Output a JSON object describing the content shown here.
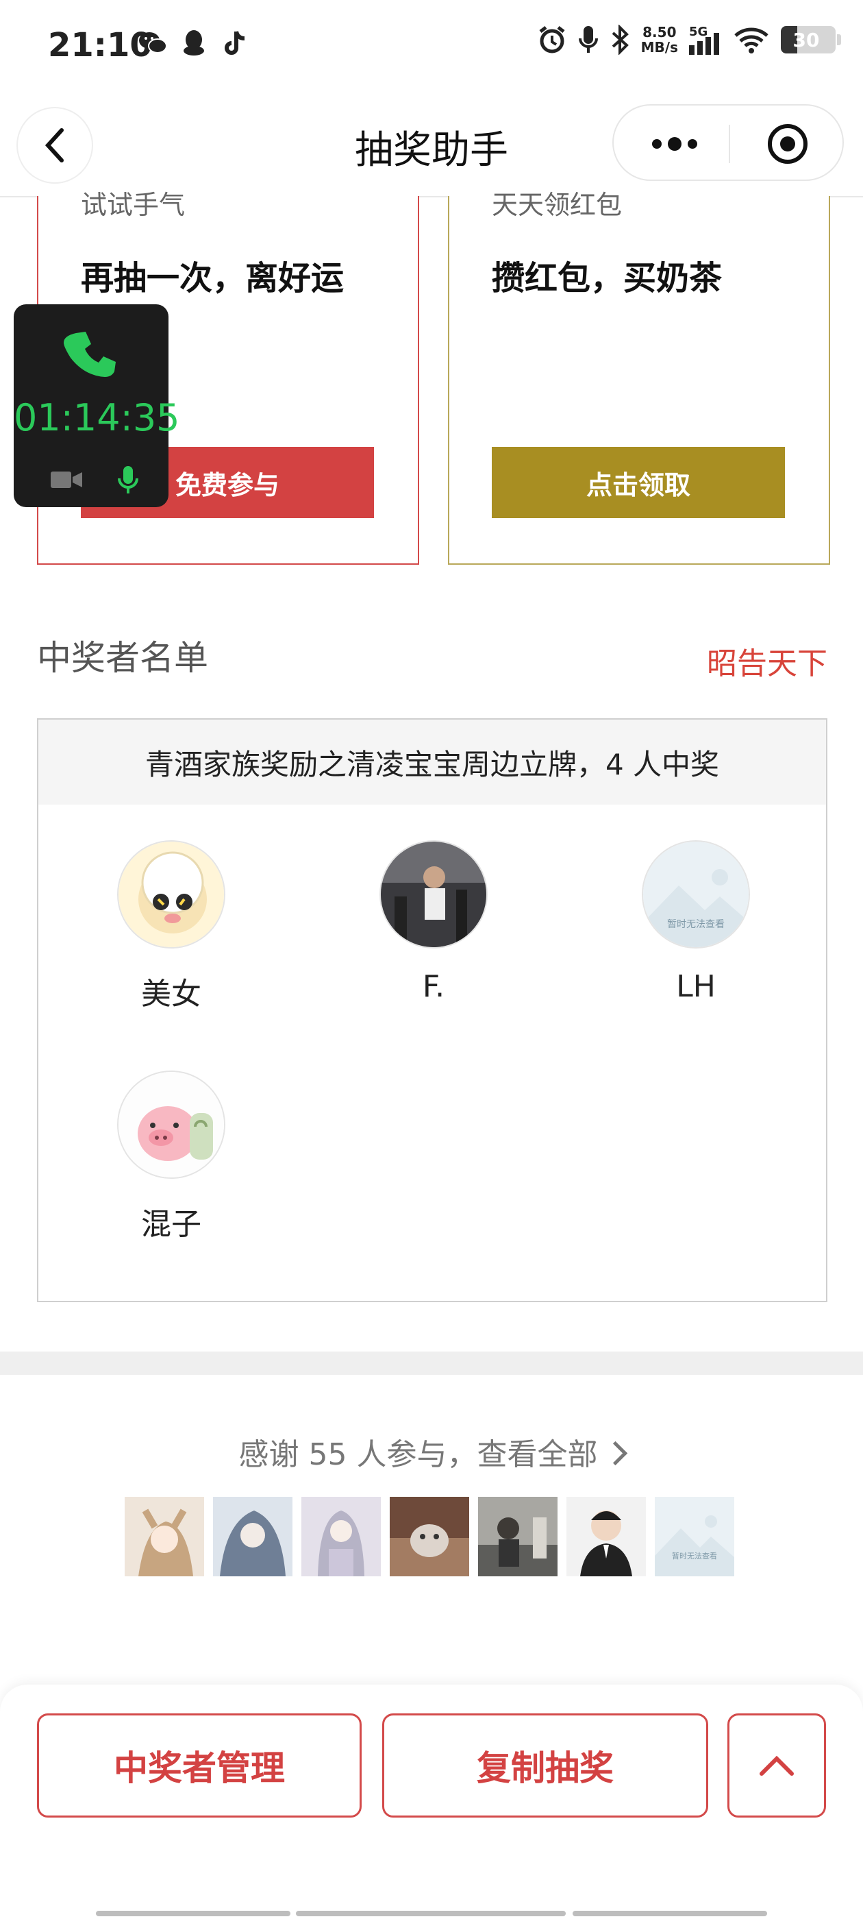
{
  "status_bar": {
    "time": "21:10",
    "speed_value": "8.50",
    "speed_unit": "MB/s",
    "network": "5G",
    "battery": "30",
    "left_icons": [
      "wechat-icon",
      "qq-icon",
      "tiktok-icon"
    ],
    "right_icons": [
      "alarm-icon",
      "mic-icon",
      "bluetooth-icon",
      "signal-icon",
      "wifi-icon",
      "battery-icon"
    ]
  },
  "nav": {
    "title": "抽奖助手",
    "back_icon": "back-chevron-icon",
    "more_icon": "more-dots-icon",
    "close_icon": "target-icon"
  },
  "cards": [
    {
      "subtitle": "试试手气",
      "title": "再抽一次，离好运",
      "button": "免费参与",
      "accent": "#d34242"
    },
    {
      "subtitle": "天天领红包",
      "title": "攒红包，买奶茶",
      "button": "点击领取",
      "accent": "#a88e22"
    }
  ],
  "call_widget": {
    "duration": "01:14:35"
  },
  "winners": {
    "section_title": "中奖者名单",
    "announce_link": "昭告天下",
    "prize_header": "青酒家族奖励之清凌宝宝周边立牌，4 人中奖",
    "list": [
      {
        "name": "美女"
      },
      {
        "name": "F."
      },
      {
        "name": "LH"
      },
      {
        "name": "混子"
      }
    ],
    "placeholder_text": "暂时无法查看"
  },
  "participants": {
    "thanks_text": "感谢 55 人参与，查看全部",
    "thumb_count_shown": 7
  },
  "bottom_bar": {
    "manage_button": "中奖者管理",
    "copy_button": "复制抽奖",
    "up_icon": "chevron-up-icon"
  },
  "colors": {
    "accent_red": "#d34242",
    "accent_gold": "#a88e22",
    "call_green": "#2bc95a"
  }
}
